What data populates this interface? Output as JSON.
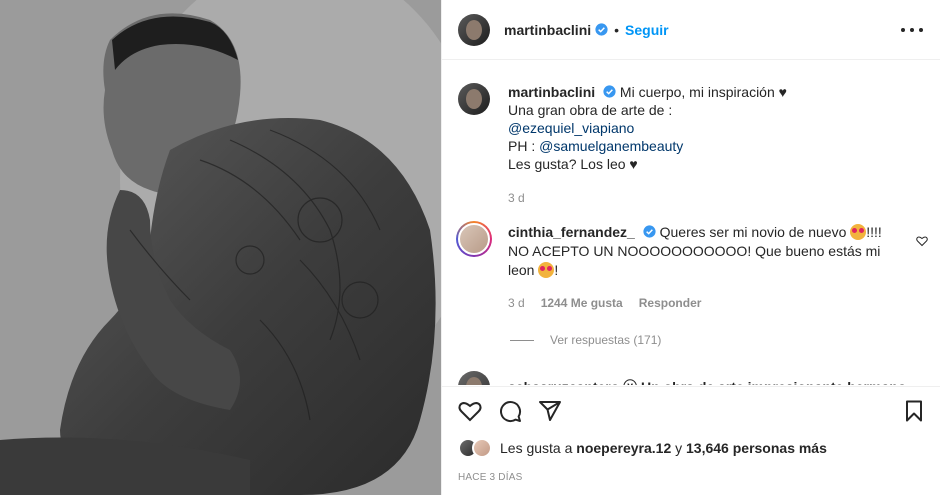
{
  "header": {
    "username": "martinbaclini",
    "separator": "•",
    "follow_label": "Seguir"
  },
  "caption": {
    "username": "martinbaclini",
    "line1": "Mi cuerpo, mi inspiración ♥",
    "line2": "Una gran obra de arte de :",
    "mention1": "@ezequiel_viapiano",
    "ph_prefix": "PH : ",
    "mention2": "@samuelganembeauty",
    "line5": "Les gusta? Los leo ♥",
    "time": "3 d"
  },
  "comment": {
    "username": "cinthia_fernandez_",
    "text_part1": "Queres ser mi novio de nuevo",
    "text_part2": "!!!! NO ACEPTO UN NOOOOOOOOOOO! Que bueno estás mi leon",
    "text_part3": "!",
    "time": "3 d",
    "likes": "1244 Me gusta",
    "reply_label": "Responder",
    "view_replies": "Ver respuestas (171)"
  },
  "next_comment": {
    "text": "sebasruzcantero ⓥ Un obra de arte impresionante hermano"
  },
  "icons": {
    "like": "heart-outline-icon",
    "comment": "comment-bubble-icon",
    "share": "paper-plane-icon",
    "save": "bookmark-icon",
    "more": "more-dots-icon"
  },
  "likes": {
    "prefix": "Les gusta a ",
    "user": "noepereyra.12",
    "middle": " y ",
    "count": "13,646 personas más"
  },
  "timeago": "HACE 3 DÍAS",
  "colors": {
    "link": "#0095f6",
    "mention": "#00376b",
    "muted": "#8e8e8e"
  }
}
